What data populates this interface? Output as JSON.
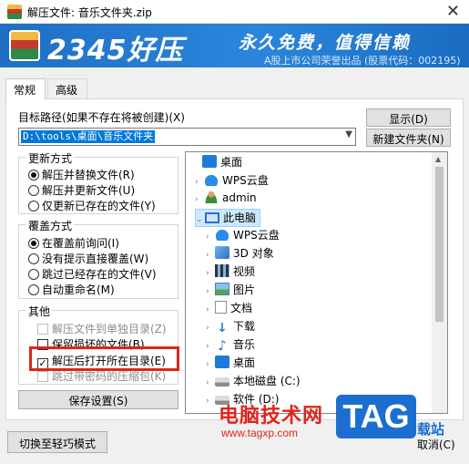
{
  "window": {
    "title": "解压文件: 音乐文件夹.zip",
    "close": "✕"
  },
  "banner": {
    "brand": "2345好压",
    "slogan": "永久免费，值得信赖",
    "sub": "A股上市公司荣誉出品 (股票代码：002195)"
  },
  "tabs": [
    "常规",
    "高级"
  ],
  "target": {
    "label": "目标路径(如果不存在将被创建)(X)",
    "path": "D:\\tools\\桌面\\音乐文件夹",
    "show_button": "显示(D)",
    "new_folder_button": "新建文件夹(N)"
  },
  "update_mode": {
    "title": "更新方式",
    "options": [
      "解压并替换文件(R)",
      "解压并更新文件(U)",
      "仅更新已存在的文件(Y)"
    ],
    "selected": 0
  },
  "overwrite_mode": {
    "title": "覆盖方式",
    "options": [
      "在覆盖前询问(I)",
      "没有提示直接覆盖(W)",
      "跳过已经存在的文件(V)",
      "自动重命名(M)"
    ],
    "selected": 0
  },
  "other": {
    "title": "其他",
    "items": [
      {
        "label": "解压文件到单独目录(Z)",
        "checked": false,
        "enabled": false
      },
      {
        "label": "保留损坏的文件(B)",
        "checked": false,
        "enabled": true
      },
      {
        "label": "解压后打开所在目录(E)",
        "checked": true,
        "enabled": true
      },
      {
        "label": "跳过带密码的压缩包(K)",
        "checked": false,
        "enabled": false
      }
    ]
  },
  "save_button": "保存设置(S)",
  "switch_button": "切换至轻巧模式",
  "cancel_button": "取消(C)",
  "tree": [
    {
      "label": "桌面",
      "icon": "desktop-icon",
      "level": 0,
      "expander": ""
    },
    {
      "label": "WPS云盘",
      "icon": "cloud-icon",
      "level": 1,
      "expander": "›"
    },
    {
      "label": "admin",
      "icon": "person-icon",
      "level": 1,
      "expander": "›"
    },
    {
      "label": "此电脑",
      "icon": "computer-icon",
      "level": 1,
      "expander": "⌄",
      "selected": true
    },
    {
      "label": "WPS云盘",
      "icon": "cloud-icon",
      "level": 2,
      "expander": "›"
    },
    {
      "label": "3D 对象",
      "icon": "cube-icon",
      "level": 2,
      "expander": "›"
    },
    {
      "label": "视频",
      "icon": "video-icon",
      "level": 2,
      "expander": "›"
    },
    {
      "label": "图片",
      "icon": "picture-icon",
      "level": 2,
      "expander": "›"
    },
    {
      "label": "文档",
      "icon": "document-icon",
      "level": 2,
      "expander": "›"
    },
    {
      "label": "下载",
      "icon": "download-icon",
      "level": 2,
      "expander": "›"
    },
    {
      "label": "音乐",
      "icon": "music-icon",
      "level": 2,
      "expander": "›"
    },
    {
      "label": "桌面",
      "icon": "desktop-icon",
      "level": 2,
      "expander": "›"
    },
    {
      "label": "本地磁盘 (C:)",
      "icon": "disk-icon",
      "level": 2,
      "expander": "›"
    },
    {
      "label": "软件 (D:)",
      "icon": "disk-icon",
      "level": 2,
      "expander": "›"
    }
  ],
  "watermark": {
    "text1": "电脑技术网",
    "text2": "www.tagxp.com",
    "badge": "TAG",
    "suffix": "载站"
  }
}
